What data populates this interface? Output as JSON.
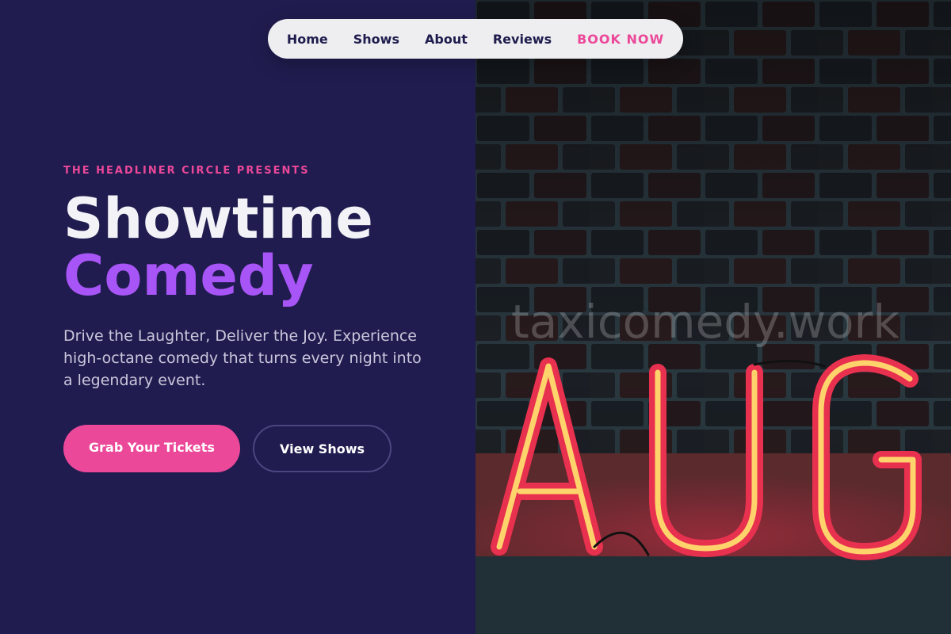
{
  "nav": {
    "items": [
      {
        "label": "Home"
      },
      {
        "label": "Shows"
      },
      {
        "label": "About"
      },
      {
        "label": "Reviews"
      }
    ],
    "cta_label": "BOOK NOW"
  },
  "hero": {
    "kicker": "THE HEADLINER CIRCLE PRESENTS",
    "title_line1": "Showtime",
    "title_line2": "Comedy",
    "lead": "Drive the Laughter, Deliver the Joy. Experience high-octane comedy that turns every night into a legendary event.",
    "primary_button": "Grab Your Tickets",
    "secondary_button": "View Shows"
  },
  "image": {
    "neon_sign_text": "AUG",
    "watermark": "taxicomedy.work"
  },
  "colors": {
    "background": "#201c4f",
    "accent_pink": "#ec4899",
    "accent_purple": "#a855f7",
    "nav_bg": "#eeeef1"
  }
}
